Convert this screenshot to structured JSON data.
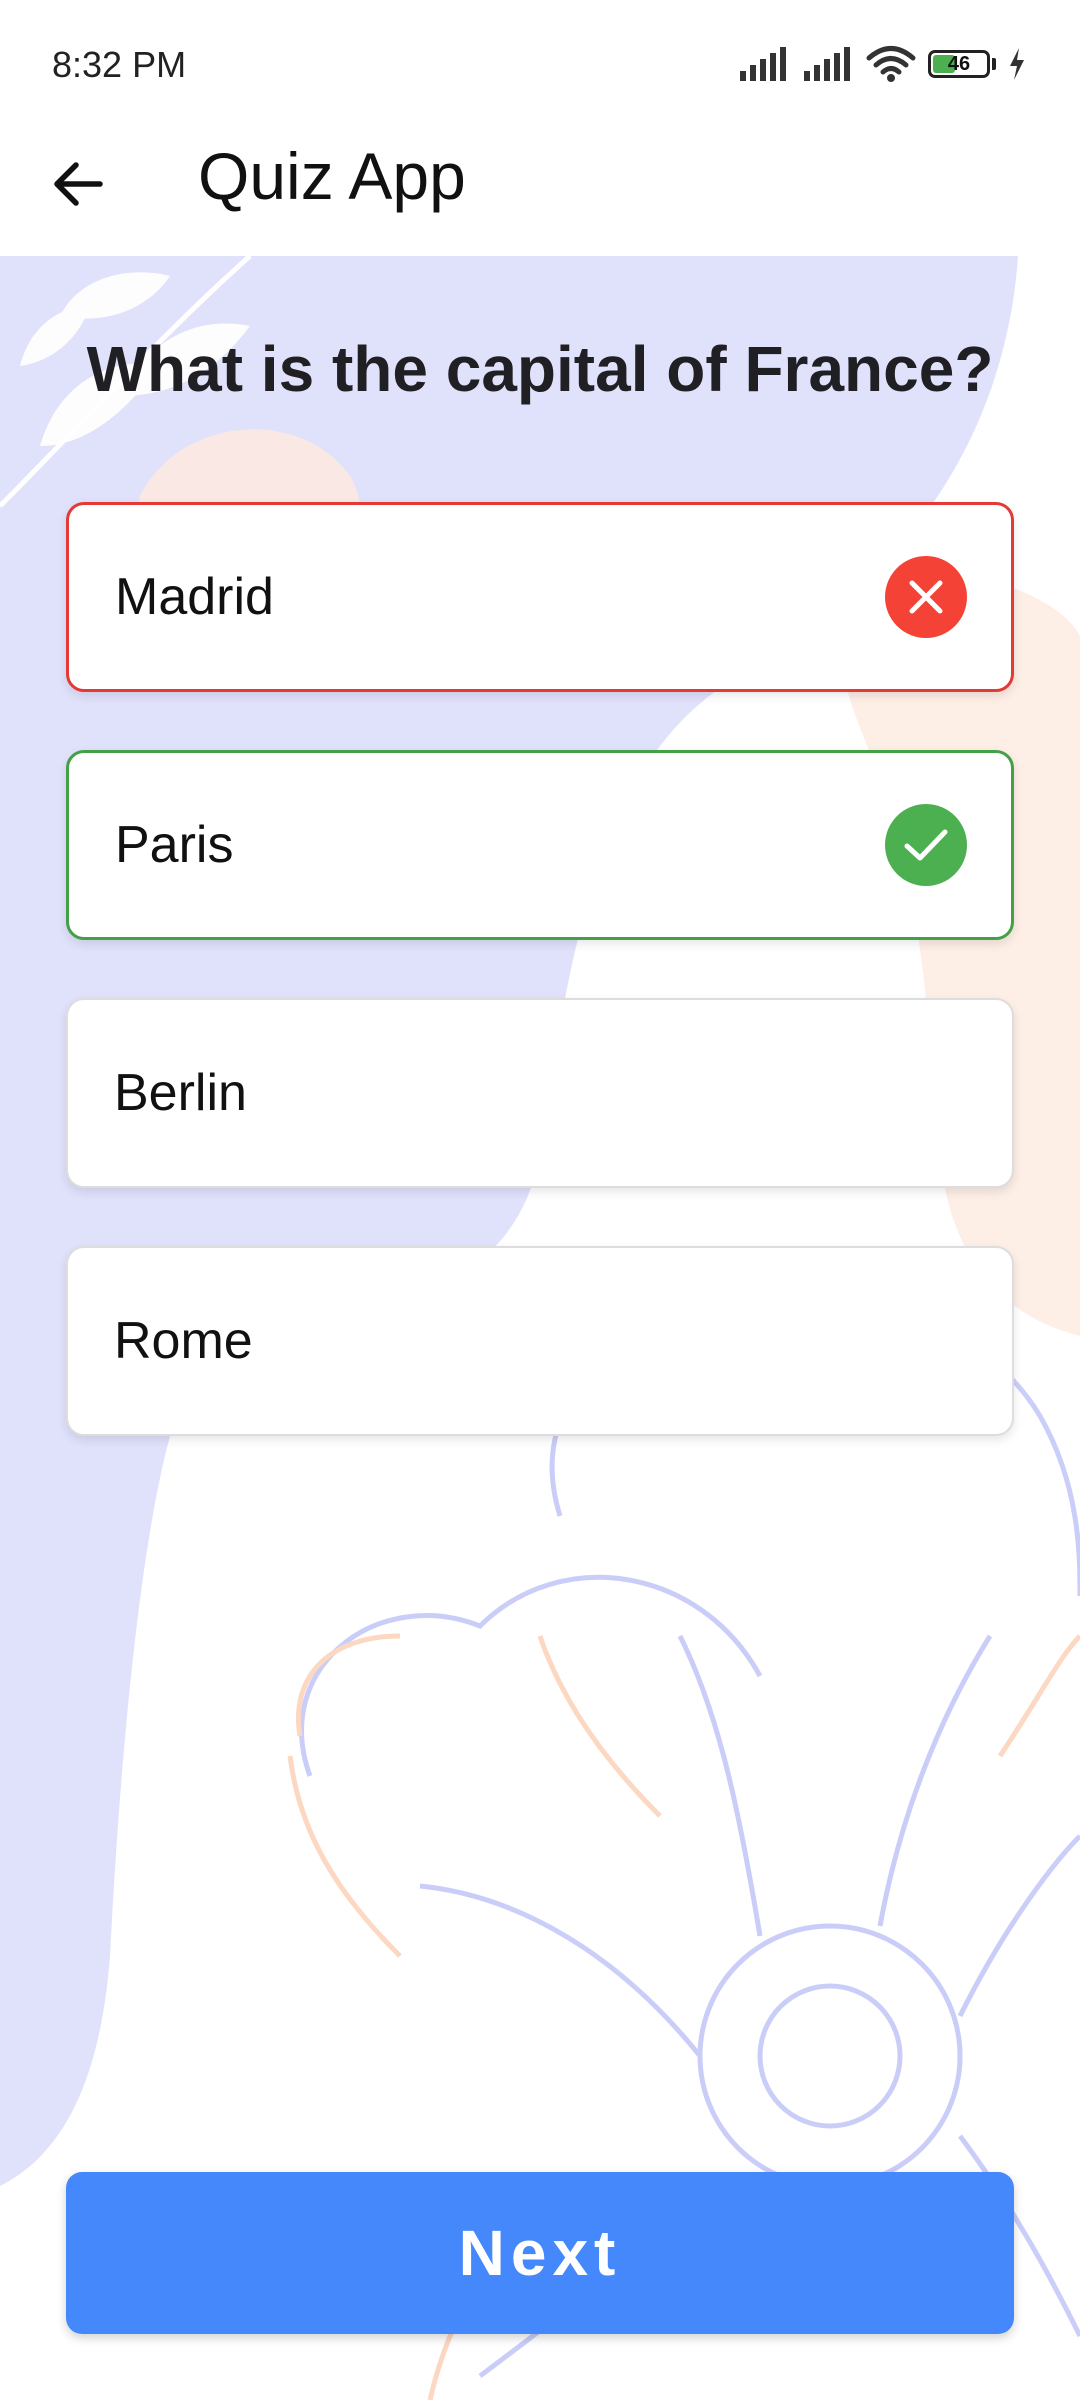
{
  "status_bar": {
    "time": "8:32 PM",
    "battery_level": "46",
    "battery_fraction": 0.46,
    "icons": [
      "signal-icon",
      "signal-icon",
      "wifi-icon",
      "battery-icon",
      "charging-icon"
    ]
  },
  "app_bar": {
    "back_icon": "back-arrow-icon",
    "title": "Quiz App"
  },
  "quiz": {
    "question": "What is the capital of France?",
    "options": [
      {
        "label": "Madrid",
        "state": "wrong",
        "icon": "close-icon"
      },
      {
        "label": "Paris",
        "state": "correct",
        "icon": "check-icon"
      },
      {
        "label": "Berlin",
        "state": "neutral"
      },
      {
        "label": "Rome",
        "state": "neutral"
      }
    ],
    "next_label": "Next"
  },
  "colors": {
    "accent": "#4588fb",
    "wrong": "#f44336",
    "correct": "#4caf50",
    "background_blob": "#e0e1fb",
    "background_orange": "#fdeee6"
  }
}
